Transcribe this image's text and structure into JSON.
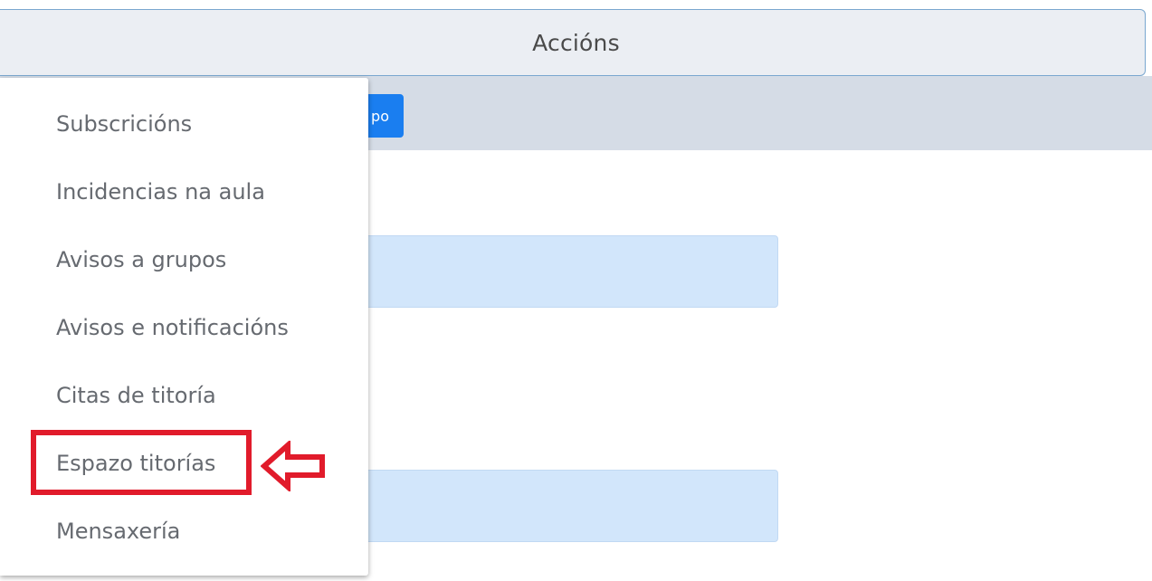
{
  "header": {
    "title": "Accións"
  },
  "toolbar": {
    "button_label": "Crear grupo"
  },
  "menu": {
    "items": [
      {
        "label": "Subscricións"
      },
      {
        "label": "Incidencias na aula"
      },
      {
        "label": "Avisos a grupos"
      },
      {
        "label": "Avisos e notificacións"
      },
      {
        "label": "Citas de titoría"
      },
      {
        "label": "Espazo titorías"
      },
      {
        "label": "Mensaxería"
      }
    ]
  },
  "annotation": {
    "color": "#e11b2b",
    "icon": "left-arrow-icon",
    "highlighted_item": "Espazo titorías"
  },
  "colors": {
    "button": "#1a7ef0",
    "input_background": "#d2e6fb",
    "toolbar_background": "#d5dce6"
  }
}
